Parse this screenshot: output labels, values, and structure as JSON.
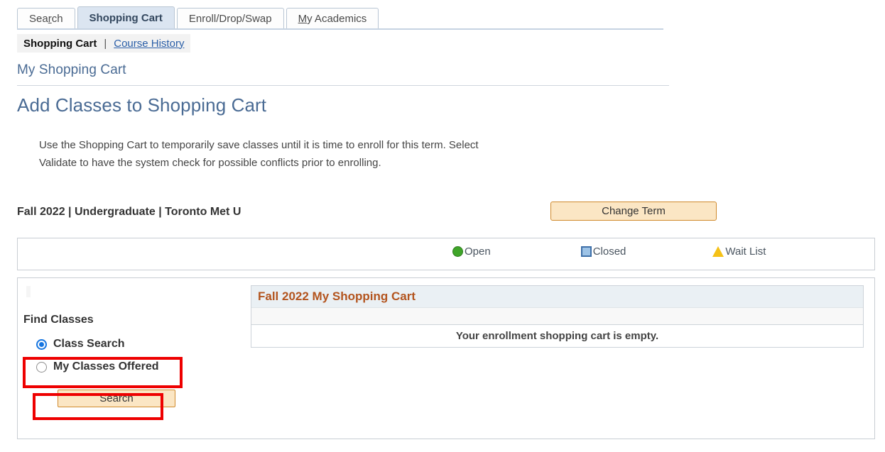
{
  "tabs": [
    {
      "label": "Search",
      "accel_index": 3,
      "active": false,
      "name": "tab-search"
    },
    {
      "label": "Shopping Cart",
      "accel_index": -1,
      "active": true,
      "name": "tab-shopping-cart"
    },
    {
      "label": "Enroll/Drop/Swap",
      "accel_index": -1,
      "active": false,
      "name": "tab-enroll-drop-swap"
    },
    {
      "label": "My Academics",
      "accel_index": 0,
      "active": false,
      "name": "tab-my-academics"
    }
  ],
  "subnav": {
    "current": "Shopping Cart",
    "separator": "|",
    "link": "Course History",
    "link_accel_index": 0
  },
  "page_title": "My Shopping Cart",
  "main_heading": "Add Classes to Shopping Cart",
  "instructions": "Use the Shopping Cart to temporarily save classes until it is time to enroll for this term.  Select\nValidate to have the system check for possible conflicts prior to enrolling.",
  "term_line": "Fall 2022 | Undergraduate | Toronto Met U",
  "change_term_label": "Change Term",
  "legend": [
    {
      "label": "Open",
      "icon": "green-circle-icon",
      "color": "#3fa529"
    },
    {
      "label": "Closed",
      "icon": "blue-square-icon",
      "color": "#9dc3e6"
    },
    {
      "label": "Wait List",
      "icon": "yellow-triangle-icon",
      "color": "#f5c117"
    }
  ],
  "find_classes": {
    "label": "Find Classes",
    "options": [
      {
        "label": "Class Search",
        "selected": true
      },
      {
        "label": "My Classes Offered",
        "selected": false
      }
    ],
    "search_button_label": "Search"
  },
  "cart": {
    "title": "Fall 2022 My Shopping Cart",
    "empty_message": "Your enrollment shopping cart is empty."
  },
  "colors": {
    "heading": "#4a6b94",
    "active_tab_bg": "#dbe5f1",
    "button_bg": "#fbe6c4",
    "button_border": "#d08a2c",
    "cart_title": "#b3541e",
    "annotation": "#ee0000",
    "radio_selected": "#1675e0"
  }
}
